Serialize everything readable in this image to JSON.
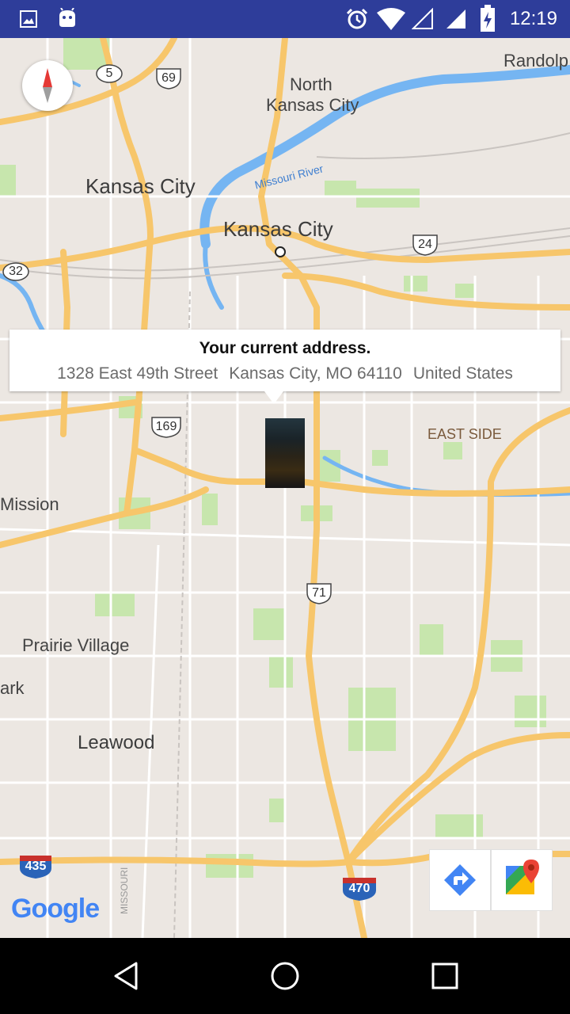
{
  "status_bar": {
    "time": "12:19",
    "bg_color": "#2e3d9a",
    "left_icons": [
      "image-icon",
      "android-icon"
    ],
    "right_icons": [
      "alarm-icon",
      "wifi-icon",
      "signal-empty-icon",
      "signal-icon",
      "battery-charging-icon"
    ]
  },
  "map": {
    "places": {
      "kc_west": "Kansas City",
      "kc_main": "Kansas City",
      "north_kc_1": "North",
      "north_kc_2": "Kansas City",
      "randolph": "Randolp",
      "missouri_river": "Missouri River",
      "east_side": "EAST SIDE",
      "mission": "Mission",
      "prairie_village": "Prairie Village",
      "ark": "ark",
      "leawood": "Leawood",
      "missouri_state": "MISSOURI"
    },
    "route_shields": {
      "r5": "5",
      "r69": "69",
      "r32": "32",
      "r24": "24",
      "r169": "169",
      "r71": "71",
      "i435": "435",
      "i470": "470"
    },
    "colors": {
      "land": "#ece7e2",
      "highway": "#f7c66b",
      "water": "#75b5f2",
      "park": "#c7e6ad"
    },
    "google_logo": "Google"
  },
  "info_window": {
    "title": "Your current address.",
    "street": "1328 East 49th Street",
    "city": "Kansas City, MO 64110",
    "country": "United States"
  },
  "toolbar": {
    "directions_icon": "directions-icon",
    "maps_icon": "google-maps-icon"
  },
  "nav_bar": {
    "back": "back-icon",
    "home": "home-icon",
    "recents": "recents-icon"
  }
}
